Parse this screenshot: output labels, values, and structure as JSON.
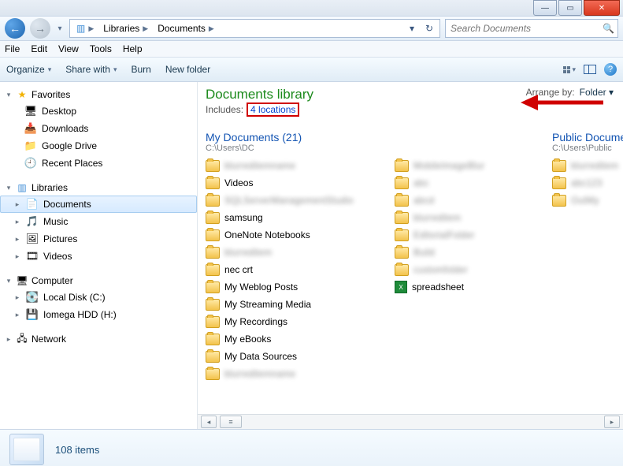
{
  "titlebar": {
    "min": "—",
    "max": "▭",
    "close": "✕"
  },
  "nav": {
    "back": "←",
    "fwd": "→",
    "breadcrumbs": [
      {
        "icon": "📚",
        "label": ""
      },
      {
        "label": "Libraries"
      },
      {
        "label": "Documents"
      }
    ],
    "refresh": "↻",
    "dropdown": "▾",
    "search_placeholder": "Search Documents"
  },
  "menubar": [
    "File",
    "Edit",
    "View",
    "Tools",
    "Help"
  ],
  "cmdbar": {
    "organize": "Organize",
    "share": "Share with",
    "burn": "Burn",
    "newfolder": "New folder"
  },
  "tree": {
    "favorites": {
      "label": "Favorites",
      "items": [
        {
          "icon": "🖥",
          "label": "Desktop"
        },
        {
          "icon": "📥",
          "label": "Downloads"
        },
        {
          "icon": "📁",
          "label": "Google Drive"
        },
        {
          "icon": "🕘",
          "label": "Recent Places"
        }
      ]
    },
    "libraries": {
      "label": "Libraries",
      "items": [
        {
          "icon": "📄",
          "label": "Documents",
          "sel": true,
          "exp": true
        },
        {
          "icon": "🎵",
          "label": "Music"
        },
        {
          "icon": "🖼",
          "label": "Pictures"
        },
        {
          "icon": "🎞",
          "label": "Videos"
        }
      ]
    },
    "computer": {
      "label": "Computer",
      "items": [
        {
          "icon": "💽",
          "label": "Local Disk (C:)"
        },
        {
          "icon": "💾",
          "label": "Iomega HDD (H:)"
        }
      ]
    },
    "network": {
      "label": "Network"
    }
  },
  "library": {
    "title": "Documents library",
    "includes_label": "Includes:",
    "locations_text": "4 locations",
    "arrange_label": "Arrange by:",
    "arrange_value": "Folder"
  },
  "sections": {
    "mydocs": {
      "title": "My Documents (21)",
      "path": "C:\\Users\\DC",
      "col1": [
        {
          "t": "blur",
          "v": "blurreditemname"
        },
        {
          "t": "f",
          "v": "Videos"
        },
        {
          "t": "blur",
          "v": "SQLServerManagementStudio"
        },
        {
          "t": "f",
          "v": "samsung"
        },
        {
          "t": "f",
          "v": "OneNote Notebooks"
        },
        {
          "t": "blur",
          "v": "blurreditem"
        },
        {
          "t": "f",
          "v": "nec crt"
        },
        {
          "t": "f",
          "v": "My Weblog Posts"
        },
        {
          "t": "f",
          "v": "My Streaming Media"
        },
        {
          "t": "f",
          "v": "My Recordings"
        },
        {
          "t": "f",
          "v": "My eBooks"
        },
        {
          "t": "ds",
          "v": "My Data Sources"
        },
        {
          "t": "blur",
          "v": "blurreditemname"
        }
      ],
      "col2": [
        {
          "t": "blur",
          "v": "MobileImageBlur"
        },
        {
          "t": "blur",
          "v": "abc"
        },
        {
          "t": "blur",
          "v": "abcd"
        },
        {
          "t": "blur",
          "v": "blurreditem"
        },
        {
          "t": "blur",
          "v": "EditorialFolder"
        },
        {
          "t": "blur",
          "v": "Build"
        },
        {
          "t": "blur",
          "v": "customfolder"
        },
        {
          "t": "xls",
          "v": "spreadsheet"
        }
      ]
    },
    "public": {
      "title": "Public Documents",
      "path": "C:\\Users\\Public",
      "col1": [
        {
          "t": "blur",
          "v": "blurreditem"
        },
        {
          "t": "blur",
          "v": "abc123"
        },
        {
          "t": "blur",
          "v": "OutMy"
        }
      ]
    }
  },
  "details": {
    "count": "108 items"
  }
}
